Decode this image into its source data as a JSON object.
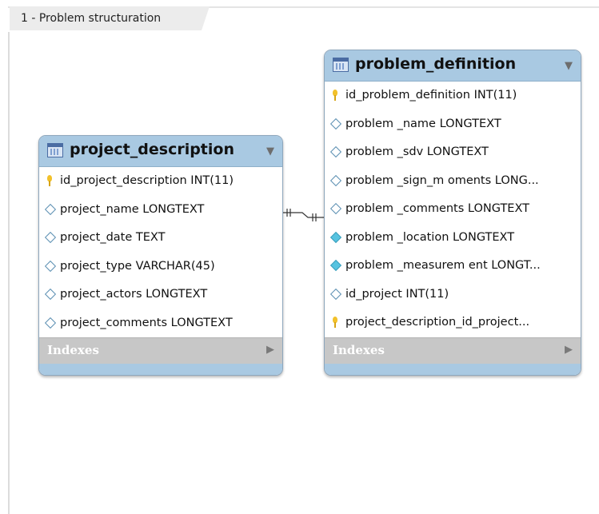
{
  "diagram_tab": {
    "label": "1 - Problem structuration"
  },
  "tables": [
    {
      "name": "project_description",
      "columns": [
        {
          "text": "id_project_description INT(11)",
          "icon": "primary-key-icon"
        },
        {
          "text": "project_name LONGTEXT",
          "icon": "column-diamond-icon"
        },
        {
          "text": "project_date TEXT",
          "icon": "column-diamond-icon"
        },
        {
          "text": "project_type VARCHAR(45)",
          "icon": "column-diamond-icon"
        },
        {
          "text": "project_actors LONGTEXT",
          "icon": "column-diamond-icon"
        },
        {
          "text": "project_comments LONGTEXT",
          "icon": "column-diamond-icon"
        }
      ],
      "indexes_label": "Indexes"
    },
    {
      "name": "problem_definition",
      "columns": [
        {
          "text": "id_problem_definition INT(11)",
          "icon": "primary-key-icon"
        },
        {
          "text": "problem _name LONGTEXT",
          "icon": "column-diamond-icon"
        },
        {
          "text": "problem _sdv LONGTEXT",
          "icon": "column-diamond-icon"
        },
        {
          "text": "problem _sign_m oments LONG...",
          "icon": "column-diamond-icon"
        },
        {
          "text": "problem _comments LONGTEXT",
          "icon": "column-diamond-icon"
        },
        {
          "text": "problem _location LONGTEXT",
          "icon": "column-diamond-filled-icon"
        },
        {
          "text": "problem _measurem ent LONGT...",
          "icon": "column-diamond-filled-icon"
        },
        {
          "text": "id_project INT(11)",
          "icon": "column-diamond-icon"
        },
        {
          "text": "project_description_id_project...",
          "icon": "foreign-key-icon"
        }
      ],
      "indexes_label": "Indexes"
    }
  ],
  "relationship": {
    "from": "project_description",
    "to": "problem_definition",
    "type": "one-to-many"
  },
  "colors": {
    "header": "#a9c9e2",
    "border": "#8ea7bd",
    "indexes_bar": "#c7c7c7",
    "key": "#f2c12a",
    "diamond_filled": "#56c3e0"
  }
}
